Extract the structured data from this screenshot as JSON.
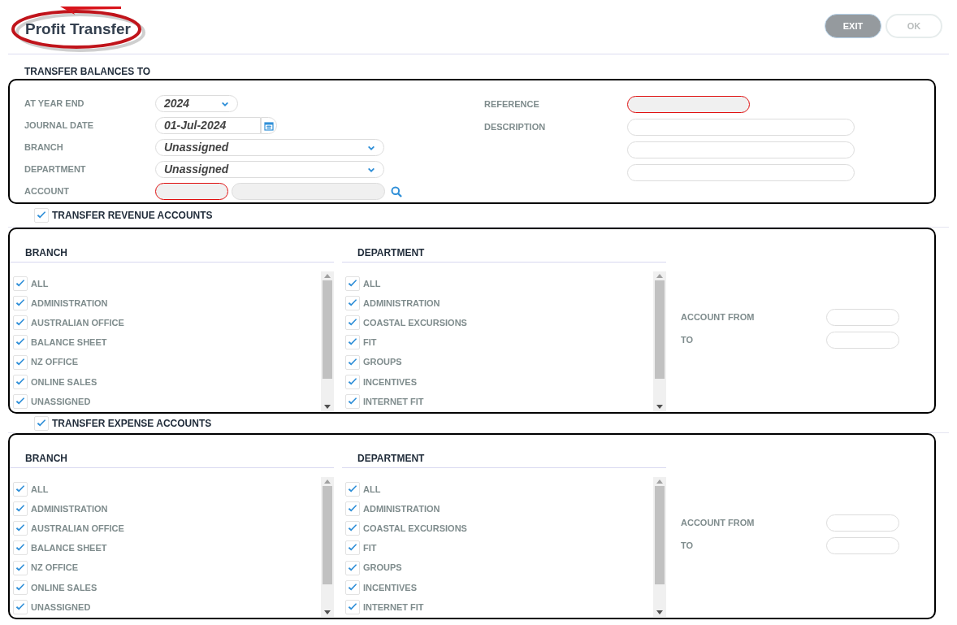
{
  "header": {
    "title": "Profit Transfer"
  },
  "buttons": [
    {
      "label": "EXIT",
      "disabled": false
    },
    {
      "label": "OK",
      "disabled": true
    }
  ],
  "balances": {
    "heading": "TRANSFER BALANCES TO",
    "left": [
      {
        "kind": "year",
        "label": "AT YEAR END",
        "value": "2024"
      },
      {
        "kind": "date",
        "label": "JOURNAL DATE",
        "value": "01-Jul-2024"
      },
      {
        "kind": "select",
        "label": "BRANCH",
        "value": "Unassigned"
      },
      {
        "kind": "select",
        "label": "DEPARTMENT",
        "value": "Unassigned"
      },
      {
        "kind": "account",
        "label": "ACCOUNT",
        "code_required": true
      }
    ],
    "right": [
      {
        "label": "REFERENCE",
        "required": true
      },
      {
        "label": "DESCRIPTION",
        "required": false
      },
      {
        "required": false
      },
      {
        "required": false
      }
    ]
  },
  "sections": [
    {
      "label": "TRANSFER REVENUE ACCOUNTS",
      "checked": true,
      "branch": {
        "heading": "BRANCH",
        "items": [
          {
            "label": "ALL",
            "checked": true
          },
          {
            "label": "ADMINISTRATION",
            "checked": true
          },
          {
            "label": "AUSTRALIAN OFFICE",
            "checked": true
          },
          {
            "label": "BALANCE SHEET",
            "checked": true
          },
          {
            "label": "NZ OFFICE",
            "checked": true
          },
          {
            "label": "ONLINE SALES",
            "checked": true
          },
          {
            "label": "UNASSIGNED",
            "checked": true
          }
        ]
      },
      "department": {
        "heading": "DEPARTMENT",
        "items": [
          {
            "label": "ALL",
            "checked": true
          },
          {
            "label": "ADMINISTRATION",
            "checked": true
          },
          {
            "label": "COASTAL EXCURSIONS",
            "checked": true
          },
          {
            "label": "FIT",
            "checked": true
          },
          {
            "label": "GROUPS",
            "checked": true
          },
          {
            "label": "INCENTIVES",
            "checked": true
          },
          {
            "label": "INTERNET FIT",
            "checked": true
          }
        ]
      },
      "account_from": "ACCOUNT FROM",
      "to": "TO"
    },
    {
      "label": "TRANSFER EXPENSE ACCOUNTS",
      "checked": true,
      "branch": {
        "heading": "BRANCH",
        "items": [
          {
            "label": "ALL",
            "checked": true
          },
          {
            "label": "ADMINISTRATION",
            "checked": true
          },
          {
            "label": "AUSTRALIAN OFFICE",
            "checked": true
          },
          {
            "label": "BALANCE SHEET",
            "checked": true
          },
          {
            "label": "NZ OFFICE",
            "checked": true
          },
          {
            "label": "ONLINE SALES",
            "checked": true
          },
          {
            "label": "UNASSIGNED",
            "checked": true
          }
        ]
      },
      "department": {
        "heading": "DEPARTMENT",
        "items": [
          {
            "label": "ALL",
            "checked": true
          },
          {
            "label": "ADMINISTRATION",
            "checked": true
          },
          {
            "label": "COASTAL EXCURSIONS",
            "checked": true
          },
          {
            "label": "FIT",
            "checked": true
          },
          {
            "label": "GROUPS",
            "checked": true
          },
          {
            "label": "INCENTIVES",
            "checked": true
          },
          {
            "label": "INTERNET FIT",
            "checked": true
          }
        ]
      },
      "account_from": "ACCOUNT FROM",
      "to": "TO"
    }
  ]
}
